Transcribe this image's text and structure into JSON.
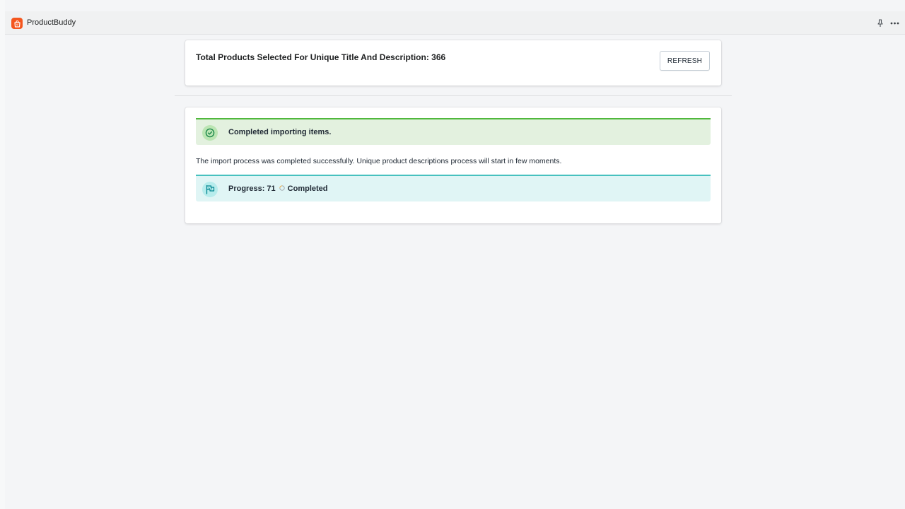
{
  "app": {
    "title": "ProductBuddy",
    "logo_icon": "shopping-bag-icon",
    "brand_color": "#f4561e"
  },
  "header_actions": {
    "pin_icon": "pin-icon",
    "more_icon": "more-horizontal-icon"
  },
  "summary": {
    "total_text": "Total Products Selected For Unique Title And Description: 366",
    "refresh_label": "REFRESH"
  },
  "status": {
    "success_title": "Completed importing items.",
    "success_icon": "check-circle-icon",
    "message": "The import process was completed successfully. Unique product descriptions process will start in few moments.",
    "progress_label": "Progress: 71",
    "progress_status": "Completed",
    "progress_icon": "flag-icon",
    "success_color": "#50b83c",
    "info_color": "#47c1bf"
  }
}
